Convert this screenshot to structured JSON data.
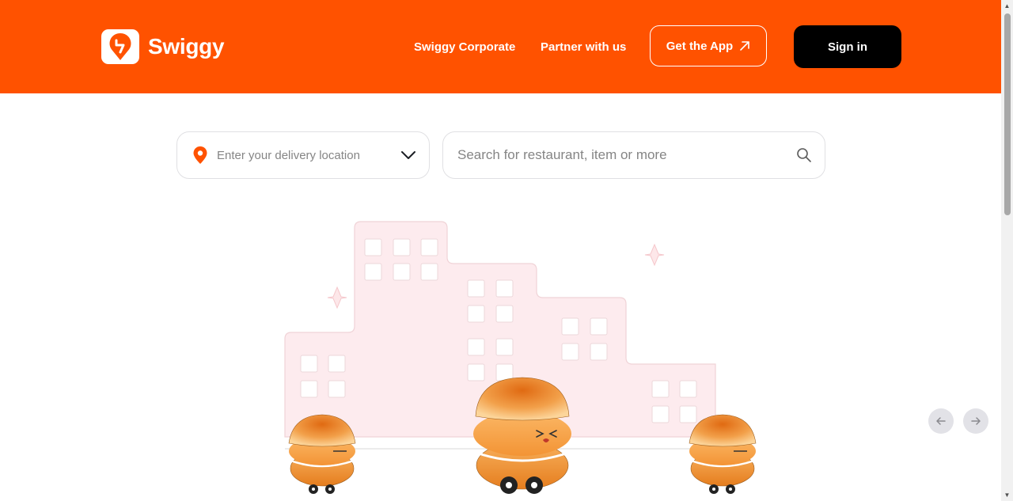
{
  "header": {
    "brand": "Swiggy",
    "nav": {
      "corporate": "Swiggy Corporate",
      "partner": "Partner with us",
      "get_app": "Get the App",
      "sign_in": "Sign in"
    },
    "bg_color": "#ff5200"
  },
  "location": {
    "placeholder": "Enter your delivery location",
    "icon": "location-pin-icon"
  },
  "search": {
    "placeholder": "Search for restaurant, item or more",
    "value": "",
    "icon": "search-icon"
  },
  "carousel": {
    "prev_icon": "arrow-left-icon",
    "next_icon": "arrow-right-icon"
  }
}
